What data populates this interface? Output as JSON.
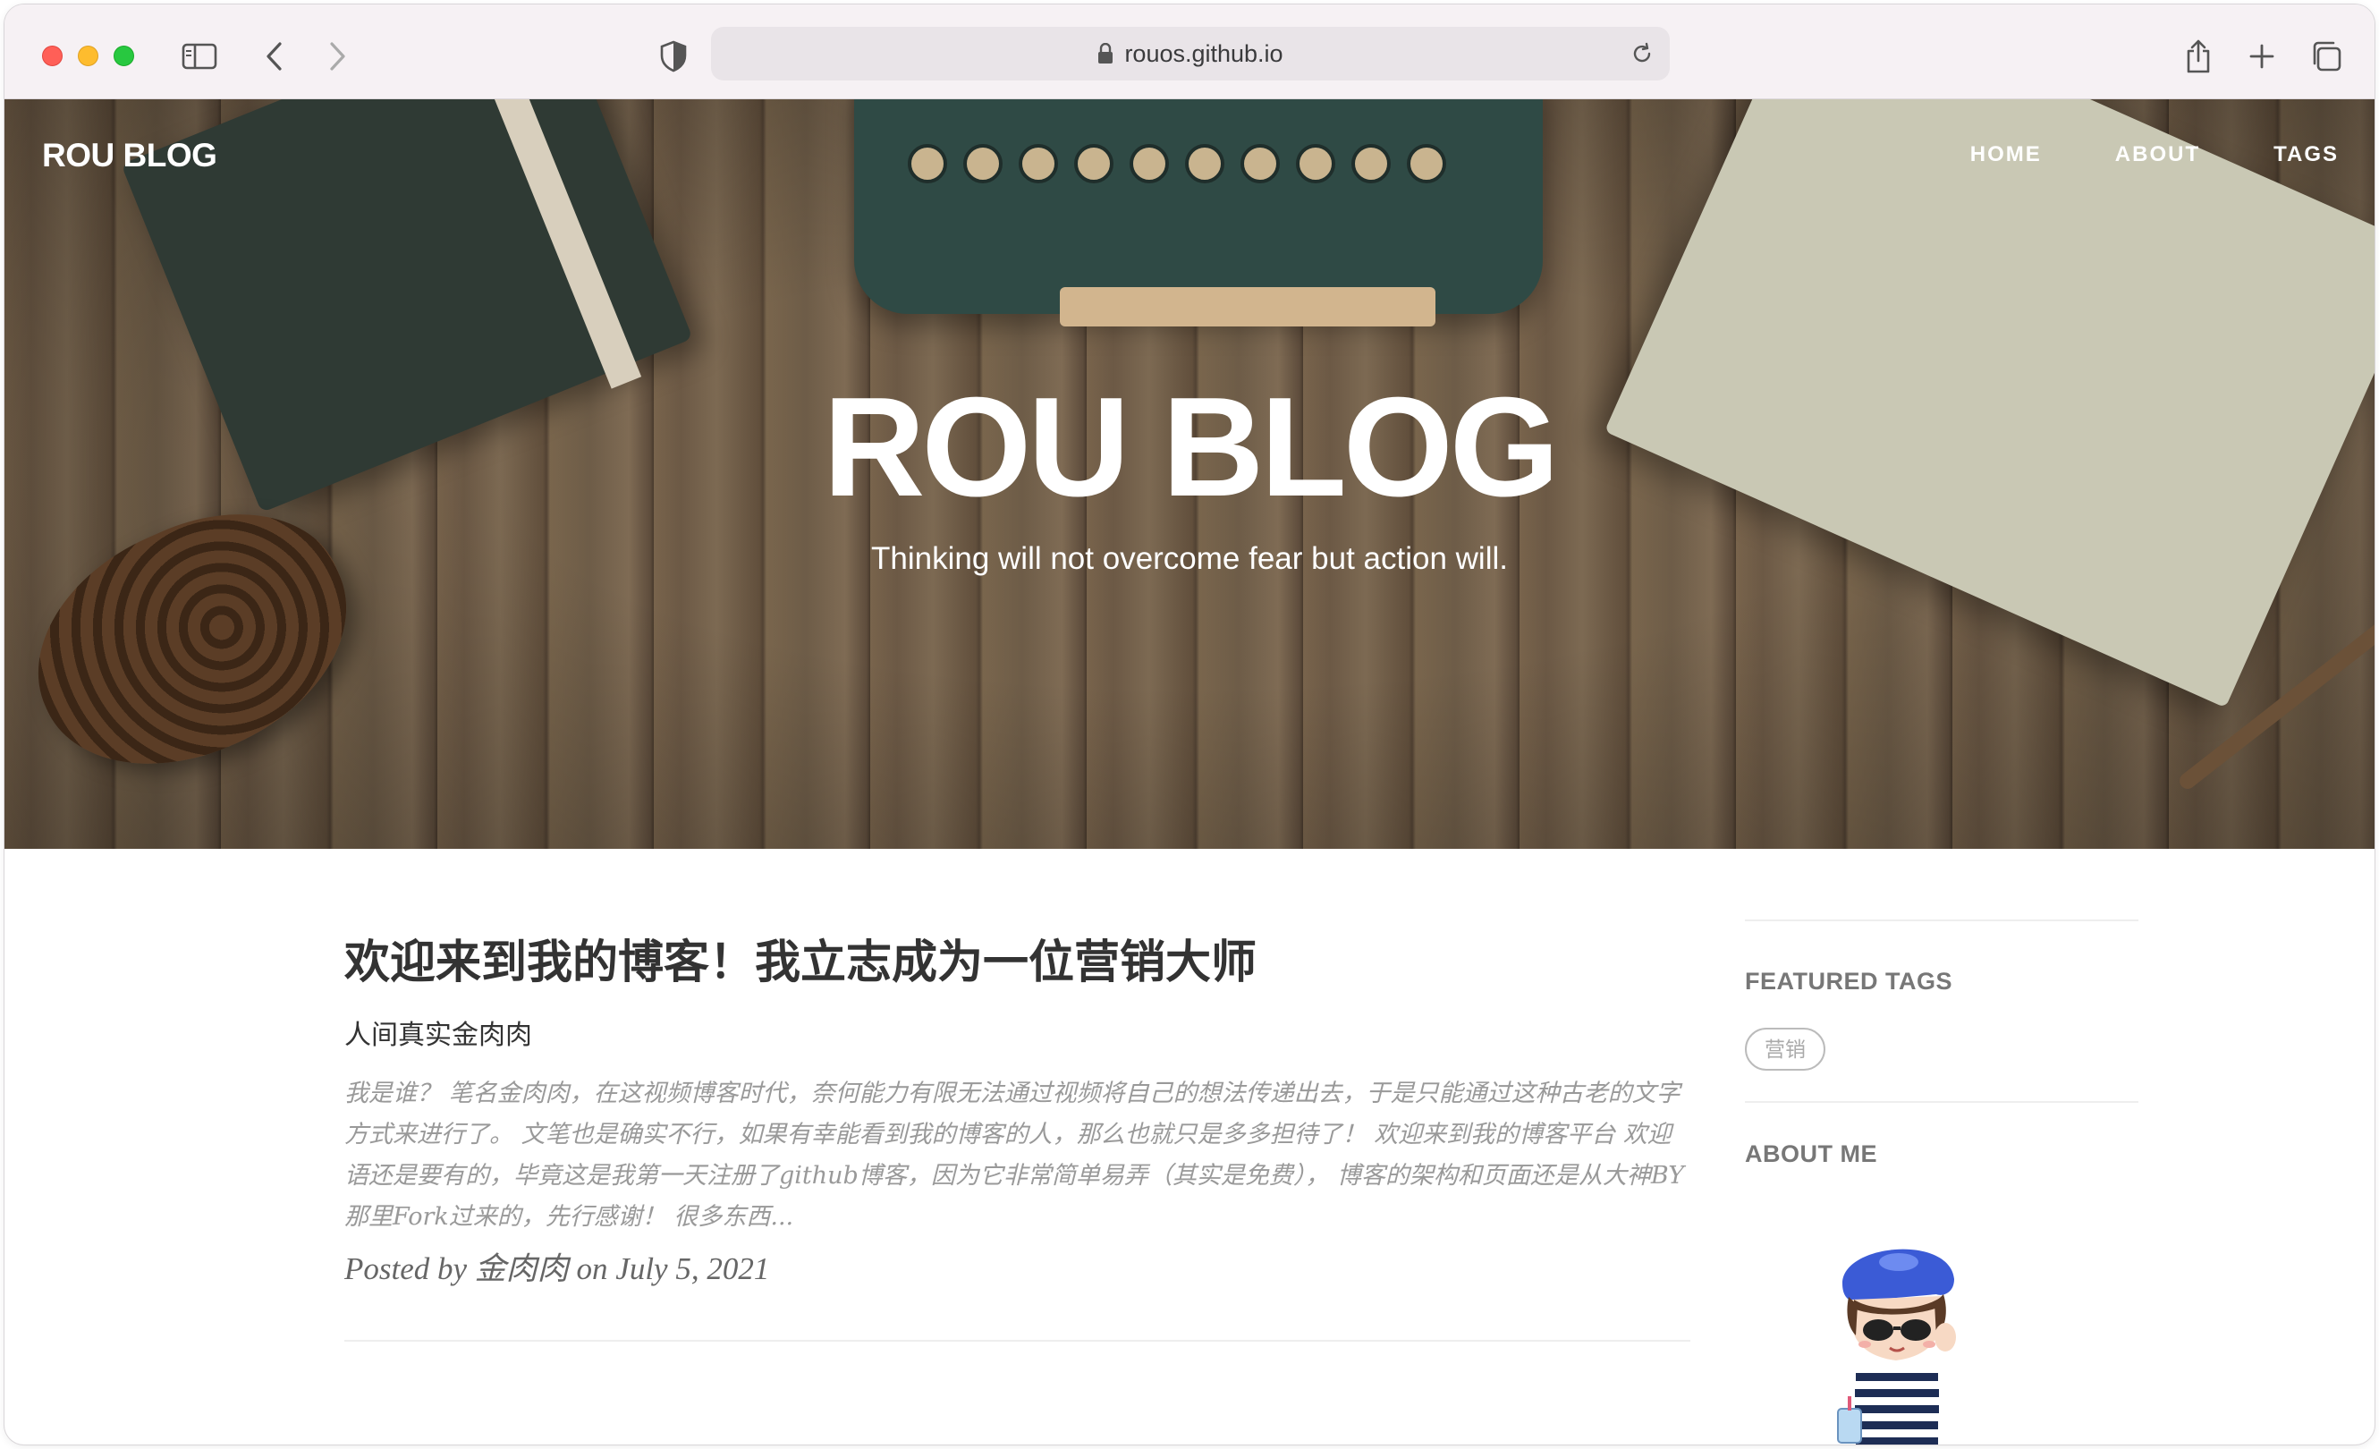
{
  "browser": {
    "url": "rouos.github.io"
  },
  "site": {
    "brand": "ROU BLOG",
    "nav": [
      "HOME",
      "ABOUT",
      "TAGS"
    ],
    "hero_title": "ROU BLOG",
    "hero_subtitle": "Thinking will not overcome fear but action will."
  },
  "post": {
    "title": "欢迎来到我的博客！我立志成为一位营销大师",
    "subtitle": "人间真实金肉肉",
    "excerpt": "我是谁？ 笔名金肉肉，在这视频博客时代，奈何能力有限无法通过视频将自己的想法传递出去，于是只能通过这种古老的文字方式来进行了。 文笔也是确实不行，如果有幸能看到我的博客的人，那么也就只是多多担待了！ 欢迎来到我的博客平台 欢迎语还是要有的，毕竟这是我第一天注册了github博客，因为它非常简单易弄（其实是免费）， 博客的架构和页面还是从大神BY那里Fork过来的，先行感谢！ 很多东西...",
    "meta": "Posted by 金肉肉 on July 5, 2021"
  },
  "sidebar": {
    "featured_tags_heading": "FEATURED TAGS",
    "tags": [
      "营销"
    ],
    "about_heading": "ABOUT ME"
  },
  "colors": {
    "traffic_red": "#ff5f57",
    "traffic_yellow": "#febc2e",
    "traffic_green": "#28c840",
    "text_dark": "#333333",
    "text_muted": "#999999"
  }
}
